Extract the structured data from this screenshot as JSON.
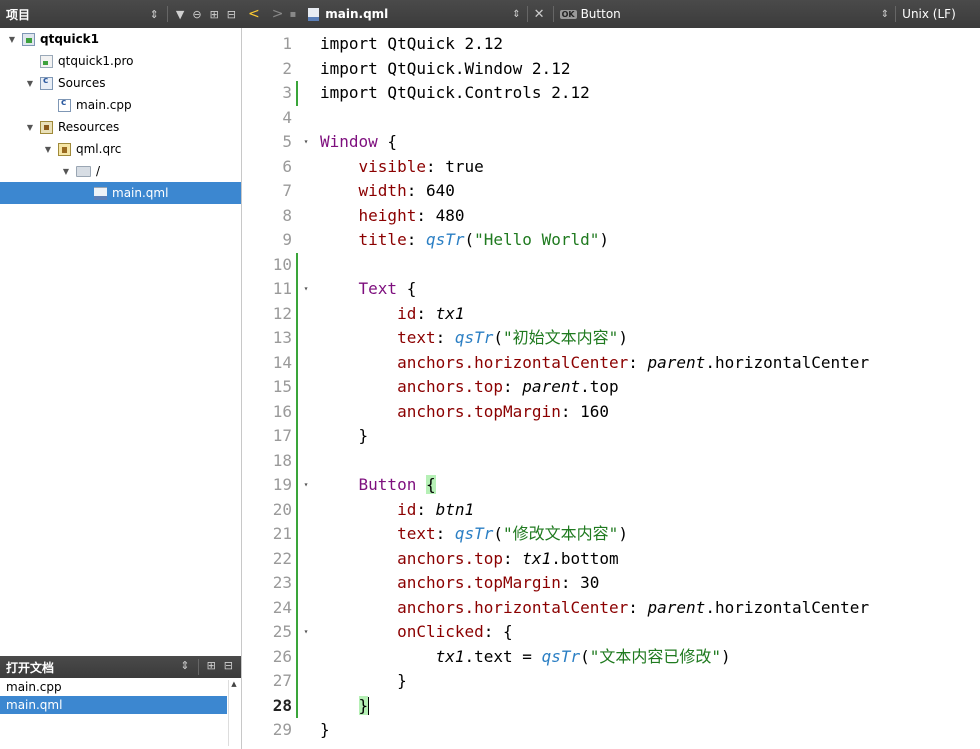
{
  "project_panel": {
    "title": "项目",
    "tree": [
      {
        "label": "qtquick1",
        "depth": 0,
        "expanded": true,
        "icon": "project-icon",
        "bold": true
      },
      {
        "label": "qtquick1.pro",
        "depth": 1,
        "icon": "pro-file-icon"
      },
      {
        "label": "Sources",
        "depth": 1,
        "expanded": true,
        "icon": "sources-icon"
      },
      {
        "label": "main.cpp",
        "depth": 2,
        "icon": "cpp-file-icon"
      },
      {
        "label": "Resources",
        "depth": 1,
        "expanded": true,
        "icon": "resources-icon"
      },
      {
        "label": "qml.qrc",
        "depth": 2,
        "expanded": true,
        "icon": "qrc-file-icon"
      },
      {
        "label": "/",
        "depth": 3,
        "expanded": true,
        "icon": "folder-icon"
      },
      {
        "label": "main.qml",
        "depth": 4,
        "icon": "qml-file-icon",
        "selected": true
      }
    ]
  },
  "open_documents": {
    "title": "打开文档",
    "items": [
      {
        "label": "main.cpp",
        "selected": false
      },
      {
        "label": "main.qml",
        "selected": true
      }
    ]
  },
  "editor_toolbar": {
    "file_name": "main.qml",
    "symbol": "Button",
    "line_ending": "Unix (LF)"
  },
  "editor": {
    "current_line": 28,
    "lines": [
      {
        "n": "1",
        "mod": false,
        "fold": ""
      },
      {
        "n": "2",
        "mod": false,
        "fold": ""
      },
      {
        "n": "3",
        "mod": true,
        "fold": ""
      },
      {
        "n": "4",
        "mod": false,
        "fold": ""
      },
      {
        "n": "5",
        "mod": false,
        "fold": "▾"
      },
      {
        "n": "6",
        "mod": false,
        "fold": ""
      },
      {
        "n": "7",
        "mod": false,
        "fold": ""
      },
      {
        "n": "8",
        "mod": false,
        "fold": ""
      },
      {
        "n": "9",
        "mod": false,
        "fold": ""
      },
      {
        "n": "10",
        "mod": true,
        "fold": ""
      },
      {
        "n": "11",
        "mod": true,
        "fold": "▾"
      },
      {
        "n": "12",
        "mod": true,
        "fold": ""
      },
      {
        "n": "13",
        "mod": true,
        "fold": ""
      },
      {
        "n": "14",
        "mod": true,
        "fold": ""
      },
      {
        "n": "15",
        "mod": true,
        "fold": ""
      },
      {
        "n": "16",
        "mod": true,
        "fold": ""
      },
      {
        "n": "17",
        "mod": true,
        "fold": ""
      },
      {
        "n": "18",
        "mod": true,
        "fold": ""
      },
      {
        "n": "19",
        "mod": true,
        "fold": "▾"
      },
      {
        "n": "20",
        "mod": true,
        "fold": ""
      },
      {
        "n": "21",
        "mod": true,
        "fold": ""
      },
      {
        "n": "22",
        "mod": true,
        "fold": ""
      },
      {
        "n": "23",
        "mod": true,
        "fold": ""
      },
      {
        "n": "24",
        "mod": true,
        "fold": ""
      },
      {
        "n": "25",
        "mod": true,
        "fold": "▾"
      },
      {
        "n": "26",
        "mod": true,
        "fold": ""
      },
      {
        "n": "27",
        "mod": true,
        "fold": ""
      },
      {
        "n": "28",
        "mod": true,
        "fold": ""
      },
      {
        "n": "29",
        "mod": false,
        "fold": ""
      }
    ],
    "code": [
      [
        {
          "t": "import QtQuick 2.12",
          "c": ""
        }
      ],
      [
        {
          "t": "import QtQuick.Window 2.12",
          "c": ""
        }
      ],
      [
        {
          "t": "import QtQuick.Controls 2.12",
          "c": ""
        }
      ],
      [],
      [
        {
          "t": "Window",
          "c": "tp"
        },
        {
          "t": " {",
          "c": ""
        }
      ],
      [
        {
          "t": "    ",
          "c": ""
        },
        {
          "t": "visible",
          "c": "pr"
        },
        {
          "t": ": true",
          "c": ""
        }
      ],
      [
        {
          "t": "    ",
          "c": ""
        },
        {
          "t": "width",
          "c": "pr"
        },
        {
          "t": ": 640",
          "c": ""
        }
      ],
      [
        {
          "t": "    ",
          "c": ""
        },
        {
          "t": "height",
          "c": "pr"
        },
        {
          "t": ": 480",
          "c": ""
        }
      ],
      [
        {
          "t": "    ",
          "c": ""
        },
        {
          "t": "title",
          "c": "pr"
        },
        {
          "t": ": ",
          "c": ""
        },
        {
          "t": "qsTr",
          "c": "fn"
        },
        {
          "t": "(",
          "c": ""
        },
        {
          "t": "\"Hello World\"",
          "c": "st"
        },
        {
          "t": ")",
          "c": ""
        }
      ],
      [],
      [
        {
          "t": "    ",
          "c": ""
        },
        {
          "t": "Text",
          "c": "tp"
        },
        {
          "t": " {",
          "c": ""
        }
      ],
      [
        {
          "t": "        ",
          "c": ""
        },
        {
          "t": "id",
          "c": "pr"
        },
        {
          "t": ": ",
          "c": ""
        },
        {
          "t": "tx1",
          "c": "it"
        }
      ],
      [
        {
          "t": "        ",
          "c": ""
        },
        {
          "t": "text",
          "c": "pr"
        },
        {
          "t": ": ",
          "c": ""
        },
        {
          "t": "qsTr",
          "c": "fn"
        },
        {
          "t": "(",
          "c": ""
        },
        {
          "t": "\"初始文本内容\"",
          "c": "st"
        },
        {
          "t": ")",
          "c": ""
        }
      ],
      [
        {
          "t": "        ",
          "c": ""
        },
        {
          "t": "anchors.horizontalCenter",
          "c": "pr"
        },
        {
          "t": ": ",
          "c": ""
        },
        {
          "t": "parent",
          "c": "it"
        },
        {
          "t": ".horizontalCenter",
          "c": ""
        }
      ],
      [
        {
          "t": "        ",
          "c": ""
        },
        {
          "t": "anchors.top",
          "c": "pr"
        },
        {
          "t": ": ",
          "c": ""
        },
        {
          "t": "parent",
          "c": "it"
        },
        {
          "t": ".top",
          "c": ""
        }
      ],
      [
        {
          "t": "        ",
          "c": ""
        },
        {
          "t": "anchors.topMargin",
          "c": "pr"
        },
        {
          "t": ": 160",
          "c": ""
        }
      ],
      [
        {
          "t": "    }",
          "c": ""
        }
      ],
      [],
      [
        {
          "t": "    ",
          "c": ""
        },
        {
          "t": "Button",
          "c": "tp"
        },
        {
          "t": " ",
          "c": ""
        },
        {
          "t": "{",
          "c": "brk"
        }
      ],
      [
        {
          "t": "        ",
          "c": ""
        },
        {
          "t": "id",
          "c": "pr"
        },
        {
          "t": ": ",
          "c": ""
        },
        {
          "t": "btn1",
          "c": "it"
        }
      ],
      [
        {
          "t": "        ",
          "c": ""
        },
        {
          "t": "text",
          "c": "pr"
        },
        {
          "t": ": ",
          "c": ""
        },
        {
          "t": "qsTr",
          "c": "fn"
        },
        {
          "t": "(",
          "c": ""
        },
        {
          "t": "\"修改文本内容\"",
          "c": "st"
        },
        {
          "t": ")",
          "c": ""
        }
      ],
      [
        {
          "t": "        ",
          "c": ""
        },
        {
          "t": "anchors.top",
          "c": "pr"
        },
        {
          "t": ": ",
          "c": ""
        },
        {
          "t": "tx1",
          "c": "it"
        },
        {
          "t": ".bottom",
          "c": ""
        }
      ],
      [
        {
          "t": "        ",
          "c": ""
        },
        {
          "t": "anchors.topMargin",
          "c": "pr"
        },
        {
          "t": ": 30",
          "c": ""
        }
      ],
      [
        {
          "t": "        ",
          "c": ""
        },
        {
          "t": "anchors.horizontalCenter",
          "c": "pr"
        },
        {
          "t": ": ",
          "c": ""
        },
        {
          "t": "parent",
          "c": "it"
        },
        {
          "t": ".horizontalCenter",
          "c": ""
        }
      ],
      [
        {
          "t": "        ",
          "c": ""
        },
        {
          "t": "onClicked",
          "c": "pr"
        },
        {
          "t": ": {",
          "c": ""
        }
      ],
      [
        {
          "t": "            ",
          "c": ""
        },
        {
          "t": "tx1",
          "c": "it"
        },
        {
          "t": ".text = ",
          "c": ""
        },
        {
          "t": "qsTr",
          "c": "fn"
        },
        {
          "t": "(",
          "c": ""
        },
        {
          "t": "\"文本内容已修改\"",
          "c": "st"
        },
        {
          "t": ")",
          "c": ""
        }
      ],
      [
        {
          "t": "        }",
          "c": ""
        }
      ],
      [
        {
          "t": "    ",
          "c": ""
        },
        {
          "t": "}",
          "c": "brk"
        },
        {
          "t": "|caret|",
          "c": "caret"
        }
      ],
      [
        {
          "t": "}",
          "c": ""
        }
      ]
    ]
  }
}
